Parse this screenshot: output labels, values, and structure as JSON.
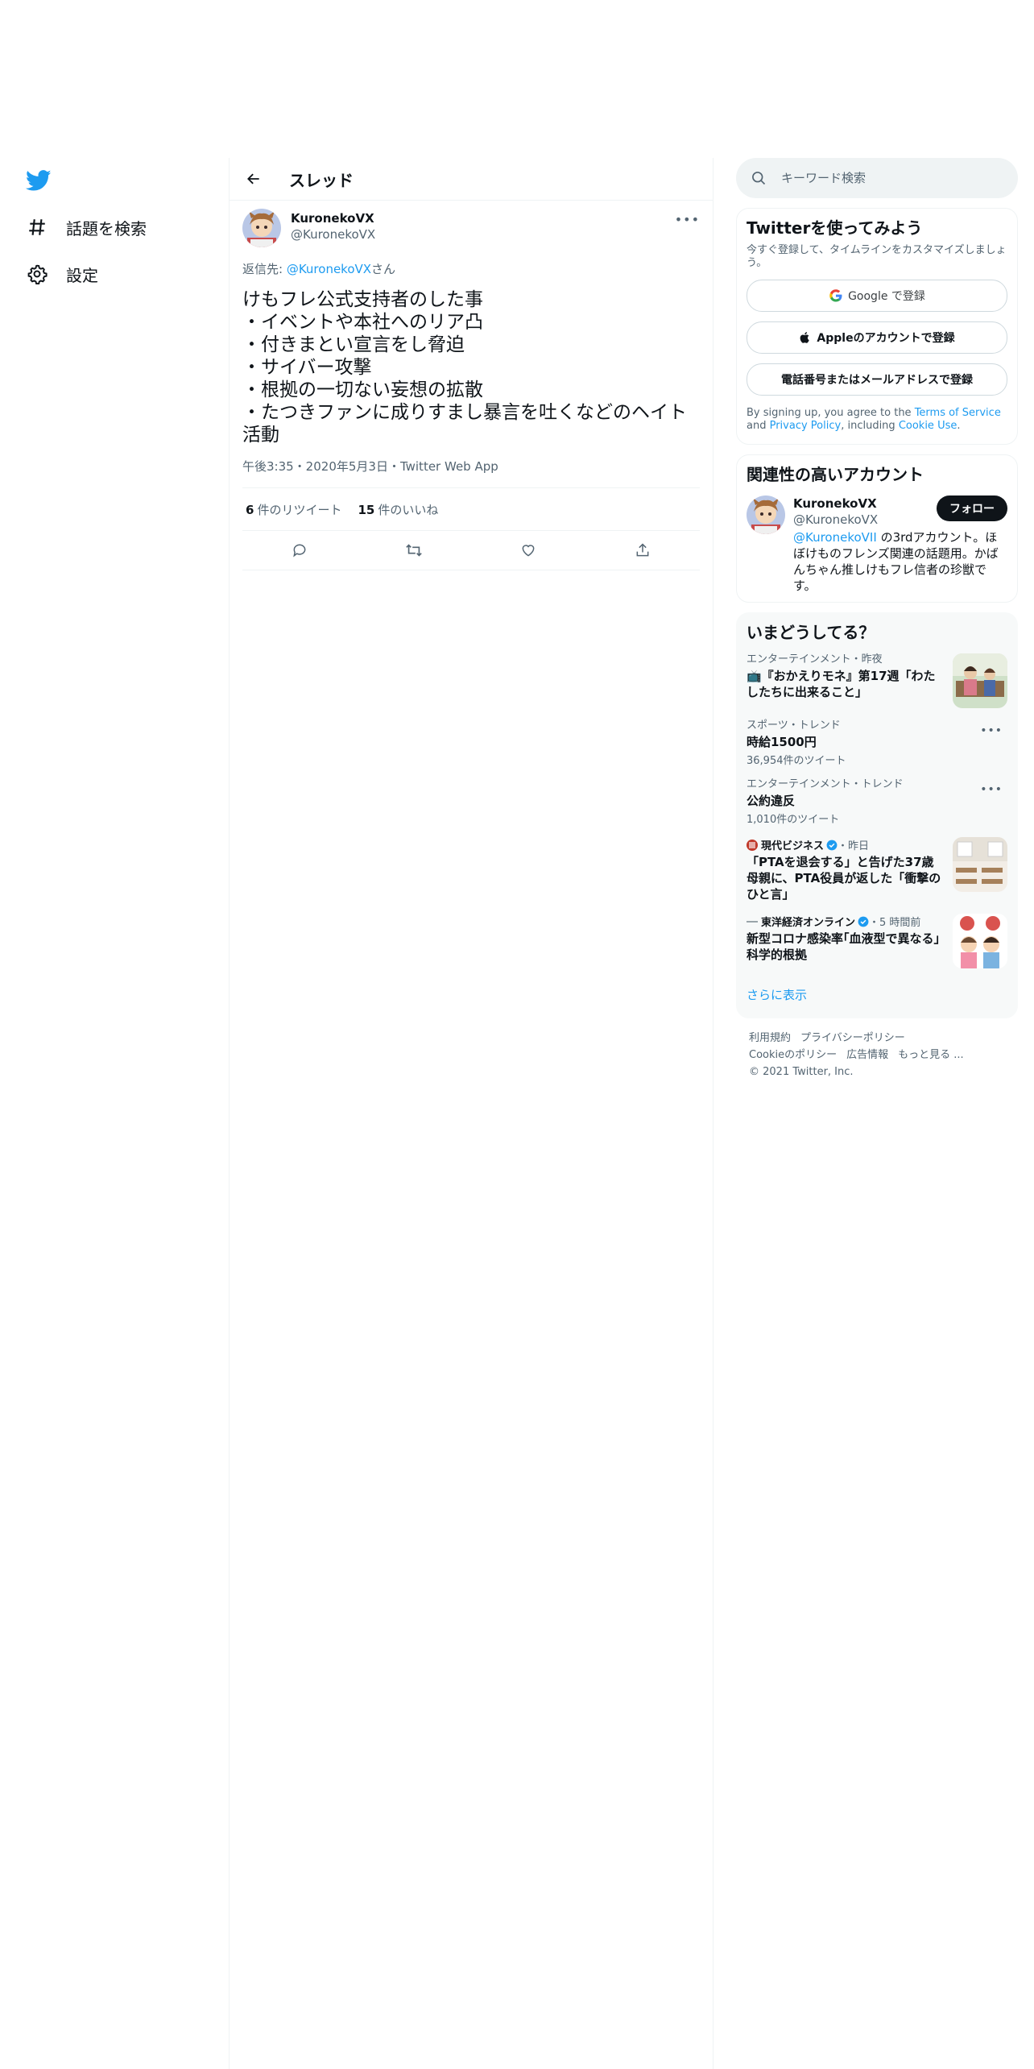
{
  "nav": {
    "items": [
      {
        "label": "話題を検索",
        "icon": "hashtag-icon"
      },
      {
        "label": "設定",
        "icon": "gear-icon"
      }
    ]
  },
  "header": {
    "title": "スレッド"
  },
  "tweet": {
    "display_name": "KuronekoVX",
    "handle": "@KuronekoVX",
    "reply_prefix": "返信先: ",
    "reply_mention": "@KuronekoVX",
    "reply_suffix": "さん",
    "text": "けもフレ公式支持者のした事\n・イベントや本社へのリア凸\n・付きまとい宣言をし脅迫\n・サイバー攻撃\n・根拠の一切ない妄想の拡散\n・たつきファンに成りすまし暴言を吐くなどのヘイト活動",
    "meta": "午後3:35・2020年5月3日・Twitter Web App",
    "retweets": "6",
    "retweets_label": "件のリツイート",
    "likes": "15",
    "likes_label": "件のいいね"
  },
  "search": {
    "placeholder": "キーワード検索"
  },
  "signup": {
    "title": "Twitterを使ってみよう",
    "subtitle": "今すぐ登録して、タイムラインをカスタマイズしましょう。",
    "google_label": "Google で登録",
    "apple_label": "Appleのアカウントで登録",
    "phone_label": "電話番号またはメールアドレスで登録",
    "legal_1": "By signing up, you agree to the ",
    "terms": "Terms of Service",
    "legal_2": " and ",
    "privacy": "Privacy Policy",
    "legal_3": ", including ",
    "cookie": "Cookie Use",
    "legal_4": "."
  },
  "related": {
    "title": "関連性の高いアカウント",
    "name": "KuronekoVX",
    "handle": "@KuronekoVX",
    "follow_label": "フォロー",
    "bio_mention": "@KuronekoVII",
    "bio_text": " の3rdアカウント。ほぼけものフレンズ関連の話題用。かばんちゃん推しけもフレ信者の珍獣です。"
  },
  "trends": {
    "title": "いまどうしてる？",
    "items": [
      {
        "context": "エンターテインメント・昨夜",
        "title": "📺『おかえりモネ』第17週「わたしたちに出来ること」"
      },
      {
        "context": "スポーツ・トレンド",
        "title": "時給1500円",
        "count": "36,954件のツイート"
      },
      {
        "context": "エンターテインメント・トレンド",
        "title": "公約違反",
        "count": "1,010件のツイート"
      },
      {
        "source": "現代ビジネス",
        "time": "・昨日",
        "title": "「PTAを退会する」と告げた37歳母親に、PTA役員が返した「衝撃のひと言」"
      },
      {
        "source": "東洋経済オンライン",
        "time": "・5 時間前",
        "title": "新型コロナ感染率｢血液型で異なる｣科学的根拠"
      }
    ],
    "show_more": "さらに表示"
  },
  "footer": {
    "links_row1": [
      "利用規約",
      "プライバシーポリシー"
    ],
    "links_row2": [
      "Cookieのポリシー",
      "広告情報",
      "もっと見る ..."
    ],
    "copyright": "© 2021 Twitter, Inc."
  },
  "colors": {
    "accent": "#1d9bf0",
    "text": "#0f1419",
    "muted": "#536471",
    "border": "#eff3f4"
  }
}
